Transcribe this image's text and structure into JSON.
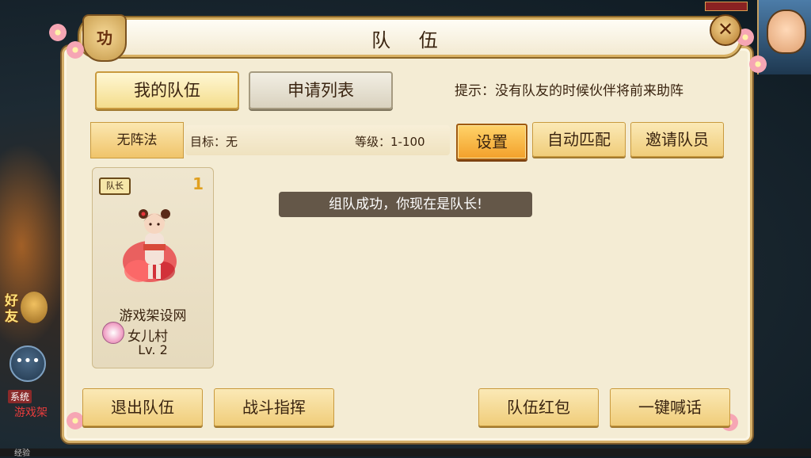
{
  "window": {
    "title": "队 伍",
    "badge_text": "功"
  },
  "tabs": [
    {
      "label": "我的队伍",
      "active": true
    },
    {
      "label": "申请列表",
      "active": false
    }
  ],
  "hint": "提示：没有队友的时候伙伴将前来助阵",
  "formation": {
    "label": "无阵法",
    "target": "目标：无",
    "level": "等级：1-100"
  },
  "actions": {
    "settings": "设置",
    "auto_match": "自动匹配",
    "invite": "邀请队员"
  },
  "members": [
    {
      "leader_tag": "队长",
      "slot": "1",
      "name": "游戏架设网",
      "school": "女儿村",
      "level": "Lv. 2"
    }
  ],
  "toast": "组队成功，你现在是队长!",
  "bottom_buttons": {
    "exit": "退出队伍",
    "command": "战斗指挥",
    "red_packet": "队伍红包",
    "shout": "一键喊话"
  },
  "hud": {
    "friends": "好友",
    "chat_icon": "chat-bubble-icon",
    "system_tag": "系统",
    "system_text": "游戏架",
    "bottom_label": "经验"
  },
  "colors": {
    "panel_bg": "#f4ecd4",
    "border_gold": "#d6b06a",
    "accent_orange": "#f2a02a",
    "text": "#3a2410"
  }
}
